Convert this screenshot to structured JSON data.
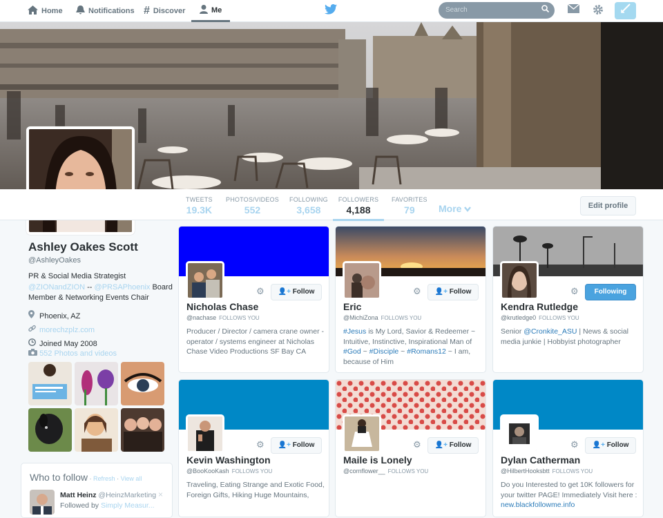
{
  "nav": {
    "home": "Home",
    "notifications": "Notifications",
    "discover": "Discover",
    "me": "Me"
  },
  "search": {
    "placeholder": "Search"
  },
  "stats": [
    {
      "label": "TWEETS",
      "value": "19.3K"
    },
    {
      "label": "PHOTOS/VIDEOS",
      "value": "552"
    },
    {
      "label": "FOLLOWING",
      "value": "3,658"
    },
    {
      "label": "FOLLOWERS",
      "value": "4,188"
    },
    {
      "label": "FAVORITES",
      "value": "79"
    }
  ],
  "more_label": "More",
  "edit_profile": "Edit profile",
  "profile": {
    "name": "Ashley Oakes Scott",
    "handle": "@AshleyOakes",
    "bio_1": "PR & Social Media Strategist",
    "bio_link1": "@ZIONandZION",
    "bio_sep": " -- ",
    "bio_link2": "@PRSAPhoenix",
    "bio_2": " Board Member & Networking Events Chair",
    "location": "Phoenix, AZ",
    "website": "morechzplz.com",
    "joined": "Joined May 2008",
    "photos_label": "552 Photos and videos"
  },
  "who_to_follow": {
    "title": "Who to follow",
    "refresh": "Refresh",
    "view_all": "View all",
    "sep": " · ",
    "user_name": "Matt Heinz",
    "user_handle": "@HeinzMarketing",
    "followed_by": "Followed by",
    "followed_by_name": "Simply Measur..."
  },
  "follows_you": "FOLLOWS YOU",
  "cards": [
    {
      "name": "Nicholas Chase",
      "handle": "@nachase",
      "follows_you": true,
      "button": "Follow",
      "bio": "Producer / Director / camera crane owner - operator / systems engineer at Nicholas Chase Video Productions SF Bay CA"
    },
    {
      "name": "Eric",
      "handle": "@MichiZona",
      "follows_you": true,
      "button": "Follow",
      "bio_parts": [
        "#Jesus",
        " is My Lord, Savior & Redeemer ~ Intuitive, Instinctive, Inspirational Man of ",
        "#God",
        " ~ ",
        "#Disciple",
        " ~ ",
        "#Romans12",
        " ~ I am, because of Him"
      ]
    },
    {
      "name": "Kendra Rutledge",
      "handle": "@krutledge0",
      "follows_you": true,
      "button": "Following",
      "bio_parts": [
        "Senior ",
        "@Cronkite_ASU",
        " | News & social media junkie | Hobbyist photographer"
      ]
    },
    {
      "name": "Kevin Washington",
      "handle": "@BooKooKash",
      "follows_you": true,
      "button": "Follow",
      "bio": "Traveling, Eating Strange and Exotic Food, Foreign Gifts, Hiking Huge Mountains,"
    },
    {
      "name": "Maile is Lonely",
      "handle": "@cornflower__",
      "follows_you": true,
      "button": "Follow",
      "bio": ""
    },
    {
      "name": "Dylan Catherman",
      "handle": "@HilbertHooksbtt",
      "follows_you": true,
      "button": "Follow",
      "bio_parts": [
        "Do you Interested to get 10K followers for your twitter PAGE! Immediately Visit here : ",
        "new.blackfollowme.info"
      ]
    }
  ],
  "colors": {
    "accent": "#55acee",
    "link": "#a8d4ef",
    "blue_banner": "#0000ff",
    "teal_banner": "#0088c6"
  }
}
